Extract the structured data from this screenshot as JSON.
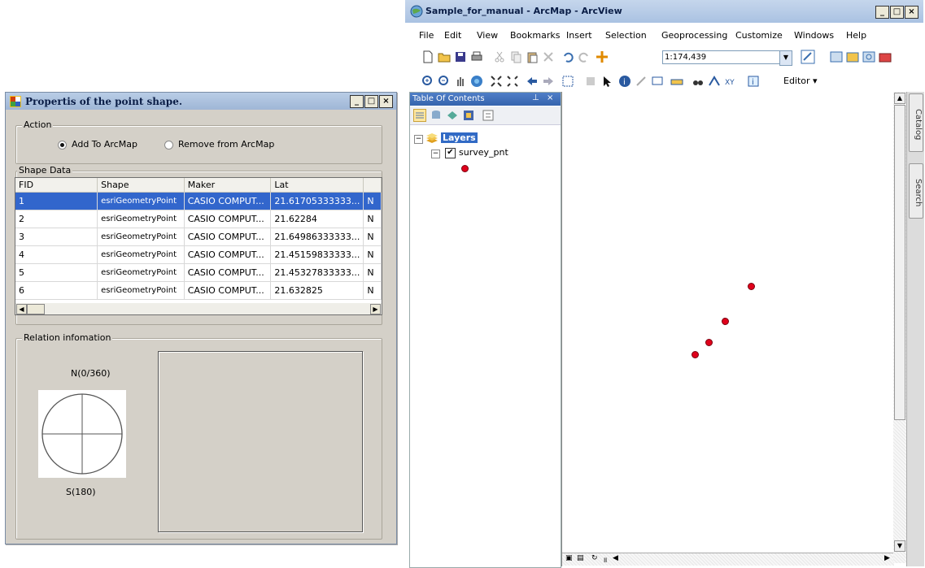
{
  "dialog": {
    "title": "Propertis of the point shape.",
    "action": {
      "group_label": "Action",
      "add_label": "Add To ArcMap",
      "remove_label": "Remove from ArcMap",
      "selected": "add"
    },
    "shape_data": {
      "group_label": "Shape Data",
      "columns": [
        "FID",
        "Shape",
        "Maker",
        "Lat"
      ],
      "rows": [
        {
          "fid": "1",
          "shape": "esriGeometryPoint",
          "maker": "CASIO COMPUT...",
          "lat": "21.61705333333...",
          "extra": "N"
        },
        {
          "fid": "2",
          "shape": "esriGeometryPoint",
          "maker": "CASIO COMPUT...",
          "lat": "21.62284",
          "extra": "N"
        },
        {
          "fid": "3",
          "shape": "esriGeometryPoint",
          "maker": "CASIO COMPUT...",
          "lat": "21.64986333333...",
          "extra": "N"
        },
        {
          "fid": "4",
          "shape": "esriGeometryPoint",
          "maker": "CASIO COMPUT...",
          "lat": "21.45159833333...",
          "extra": "N"
        },
        {
          "fid": "5",
          "shape": "esriGeometryPoint",
          "maker": "CASIO COMPUT...",
          "lat": "21.45327833333...",
          "extra": "N"
        },
        {
          "fid": "6",
          "shape": "esriGeometryPoint",
          "maker": "CASIO COMPUT...",
          "lat": "21.632825",
          "extra": "N"
        }
      ],
      "selected_row": 0
    },
    "relation": {
      "group_label": "Relation infomation",
      "north_label": "N(0/360)",
      "south_label": "S(180)"
    }
  },
  "arcmap": {
    "title": "Sample_for_manual - ArcMap - ArcView",
    "menu": [
      "File",
      "Edit",
      "View",
      "Bookmarks",
      "Insert",
      "Selection",
      "Geoprocessing",
      "Customize",
      "Windows",
      "Help"
    ],
    "scale": "1:174,439",
    "editor_label": "Editor",
    "toc": {
      "title": "Table Of Contents",
      "root_label": "Layers",
      "layer_label": "survey_pnt",
      "layer_checked": true,
      "symbol_color": "#e0001b"
    },
    "dock_tabs": [
      "Catalog",
      "Search"
    ],
    "colors": {
      "title_bar": "#aac2e2",
      "toc_header": "#3564ad",
      "point": "#e0001b",
      "selection": "#3266cc"
    }
  }
}
